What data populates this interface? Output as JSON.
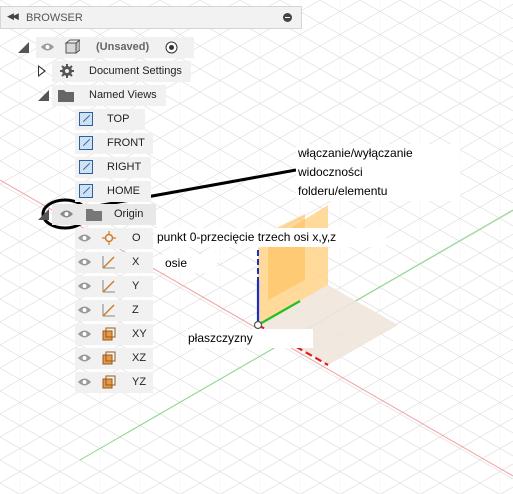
{
  "browser": {
    "header_title": "BROWSER",
    "root_label": "(Unsaved)",
    "document_settings": "Document Settings",
    "named_views": "Named Views",
    "views": [
      "TOP",
      "FRONT",
      "RIGHT",
      "HOME"
    ],
    "origin": "Origin",
    "origin_items": [
      "O",
      "X",
      "Y",
      "Z",
      "XY",
      "XZ",
      "YZ"
    ]
  },
  "annotations": {
    "visibility": "włączanie/wyłączanie widoczności folderu/elementu",
    "visibility_lines": [
      "włączanie/wyłączanie",
      "widoczności",
      "folderu/elementu"
    ],
    "origin_point": "punkt 0-przecięcie trzech osi x,y,z",
    "axes": "osie",
    "planes": "płaszczyzny"
  },
  "colors": {
    "accent_orange": "#f5a623",
    "axis_x": "#e02020",
    "axis_y": "#2a9a2a",
    "axis_z": "#1a2ec8"
  }
}
